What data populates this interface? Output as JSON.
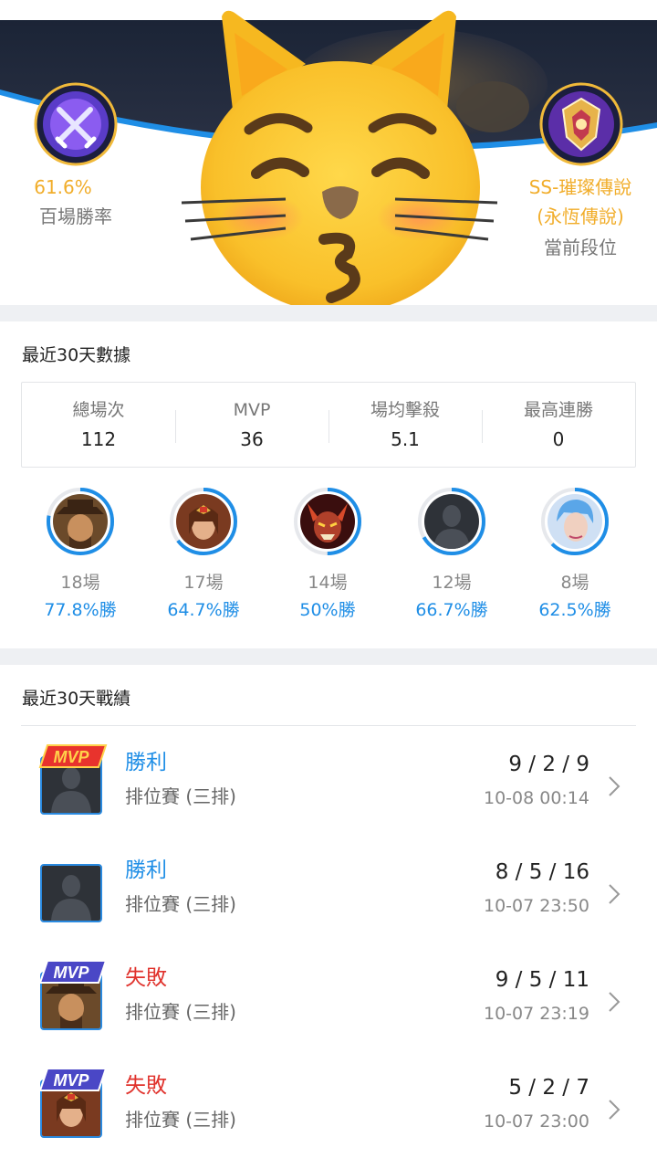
{
  "header": {
    "win_rate_value": "61.6%",
    "win_rate_label": "百場勝率",
    "rank_value_line1": "SS-璀璨傳說",
    "rank_value_line2": "(永恆傳說)",
    "rank_label": "當前段位",
    "win_badge_icon": "crossed-swords-badge-icon",
    "rank_badge_icon": "legend-rank-crest-icon",
    "overlay_sticker": "kissing-cat-emoji"
  },
  "stats30": {
    "title": "最近30天數據",
    "items": [
      {
        "label": "總場次",
        "value": "112"
      },
      {
        "label": "MVP",
        "value": "36"
      },
      {
        "label": "場均擊殺",
        "value": "5.1"
      },
      {
        "label": "最高連勝",
        "value": "0"
      }
    ]
  },
  "heroes": [
    {
      "games": "18場",
      "rate": "77.8%勝",
      "win_fraction": 0.778,
      "avatar": "cowboy-hero-avatar"
    },
    {
      "games": "17場",
      "rate": "64.7%勝",
      "win_fraction": 0.647,
      "avatar": "wonder-woman-hero-avatar"
    },
    {
      "games": "14場",
      "rate": "50%勝",
      "win_fraction": 0.5,
      "avatar": "demon-hero-avatar"
    },
    {
      "games": "12場",
      "rate": "66.7%勝",
      "win_fraction": 0.667,
      "avatar": "placeholder-silhouette-avatar"
    },
    {
      "games": "8場",
      "rate": "62.5%勝",
      "win_fraction": 0.625,
      "avatar": "blue-hair-hero-avatar"
    }
  ],
  "matches30": {
    "title": "最近30天戰績",
    "items": [
      {
        "result": "勝利",
        "outcome": "win",
        "mode": "排位賽 (三排)",
        "kda": "9 / 2 / 9",
        "time": "10-08 00:14",
        "mvp": true,
        "mvp_color": "#e8332d",
        "avatar": "placeholder-silhouette-avatar"
      },
      {
        "result": "勝利",
        "outcome": "win",
        "mode": "排位賽 (三排)",
        "kda": "8 / 5 / 16",
        "time": "10-07 23:50",
        "mvp": false,
        "avatar": "placeholder-silhouette-avatar"
      },
      {
        "result": "失敗",
        "outcome": "loss",
        "mode": "排位賽 (三排)",
        "kda": "9 / 5 / 11",
        "time": "10-07 23:19",
        "mvp": true,
        "mvp_color": "#4a47c6",
        "avatar": "cowboy-hero-avatar"
      },
      {
        "result": "失敗",
        "outcome": "loss",
        "mode": "排位賽 (三排)",
        "kda": "5 / 2 / 7",
        "time": "10-07 23:00",
        "mvp": true,
        "mvp_color": "#4a47c6",
        "avatar": "wonder-woman-hero-avatar"
      }
    ],
    "mvp_badge_text": "MVP"
  },
  "colors": {
    "accent_blue": "#1f8ee6",
    "win_blue": "#1f8ee6",
    "loss_red": "#e0322c",
    "gold": "#f1ad2a"
  }
}
